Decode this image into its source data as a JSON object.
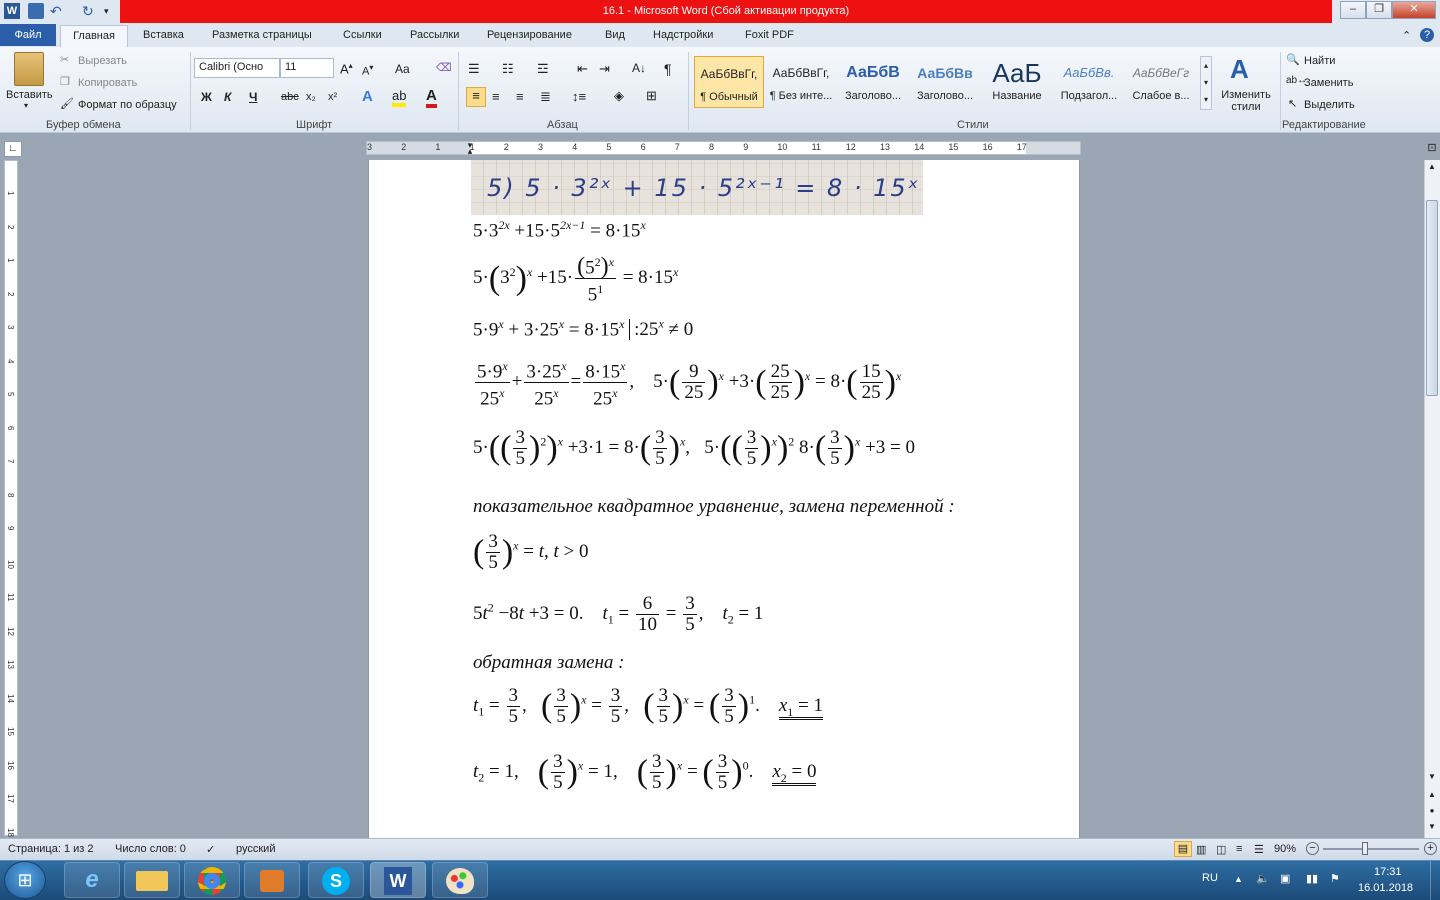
{
  "window": {
    "title": "16.1  -  Microsoft Word (Сбой активации продукта)",
    "app_icon_letter": "W"
  },
  "tabs": {
    "file": "Файл",
    "items": [
      "Главная",
      "Вставка",
      "Разметка страницы",
      "Ссылки",
      "Рассылки",
      "Рецензирование",
      "Вид",
      "Надстройки",
      "Foxit PDF"
    ]
  },
  "ribbon": {
    "clipboard": {
      "paste": "Вставить",
      "cut": "Вырезать",
      "copy": "Копировать",
      "format_painter": "Формат по образцу",
      "label": "Буфер обмена"
    },
    "font": {
      "name": "Calibri (Осно",
      "size": "11",
      "bold": "Ж",
      "italic": "К",
      "underline": "Ч",
      "strike": "abc",
      "sub": "x₂",
      "sup": "x²",
      "case": "Aa",
      "label": "Шрифт"
    },
    "paragraph": {
      "label": "Абзац",
      "pilcrow": "¶"
    },
    "styles": {
      "label": "Стили",
      "items": [
        {
          "sample": "АаБбВвГг,",
          "name": "¶ Обычный"
        },
        {
          "sample": "АаБбВвГг,",
          "name": "¶ Без инте..."
        },
        {
          "sample": "АаБбВ",
          "name": "Заголово..."
        },
        {
          "sample": "АаБбВв",
          "name": "Заголово..."
        },
        {
          "sample": "АаБ",
          "name": "Название"
        },
        {
          "sample": "АаБбВв.",
          "name": "Подзагол..."
        },
        {
          "sample": "АаБбВеГг",
          "name": "Слабое в..."
        }
      ],
      "change": "Изменить стили"
    },
    "editing": {
      "find": "Найти",
      "replace": "Заменить",
      "select": "Выделить",
      "label": "Редактирование"
    }
  },
  "ruler": {
    "h_ticks": [
      "3",
      "2",
      "1",
      "1",
      "2",
      "3",
      "4",
      "5",
      "6",
      "7",
      "8",
      "9",
      "10",
      "11",
      "12",
      "13",
      "14",
      "15",
      "16",
      "17"
    ],
    "v_ticks": [
      "1",
      "2",
      "1",
      "2",
      "3",
      "4",
      "5",
      "6",
      "7",
      "8",
      "9",
      "10",
      "11",
      "12",
      "13",
      "14",
      "15",
      "16",
      "17",
      "18",
      "19"
    ]
  },
  "document": {
    "handwritten": "5)  5 · 3²ˣ + 15 · 5²ˣ⁻¹ = 8 · 15ˣ",
    "text_substitution": "показательное квадратное уравнение, замена переменной :",
    "text_reverse": "обратная замена :"
  },
  "status": {
    "page": "Страница: 1 из 2",
    "words": "Число слов: 0",
    "lang": "русский",
    "zoom": "90%"
  },
  "taskbar": {
    "lang": "RU",
    "time": "17:31",
    "date": "16.01.2018"
  }
}
